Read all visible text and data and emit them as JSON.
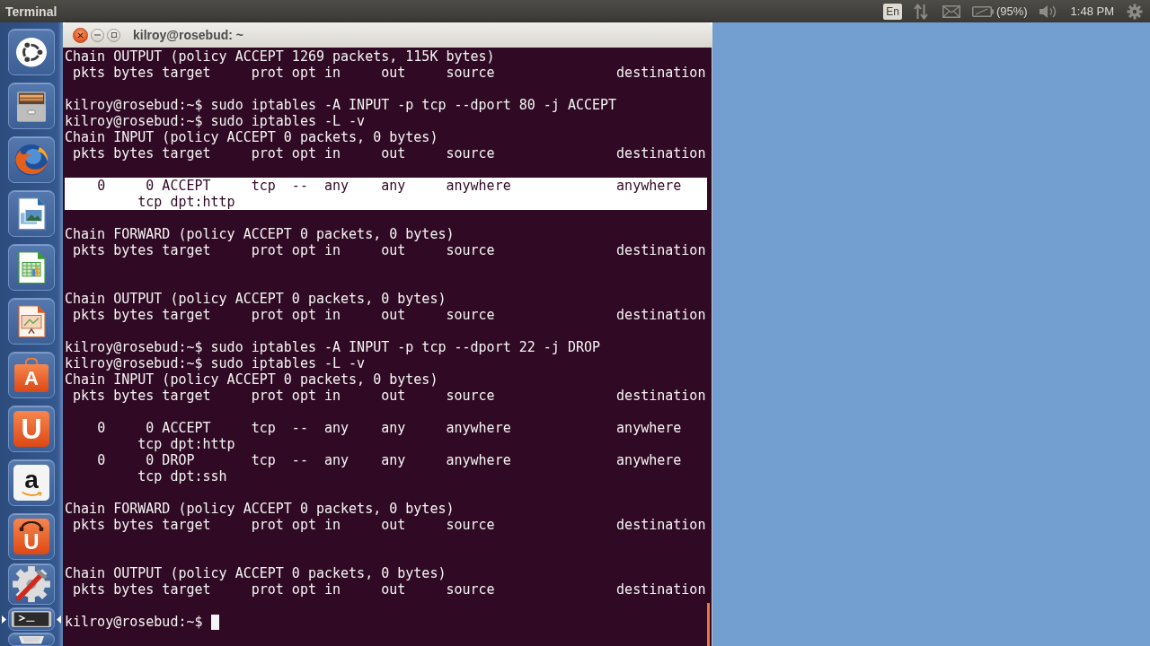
{
  "top_panel": {
    "app_title": "Terminal",
    "indicators": [
      {
        "kind": "keyboard",
        "label": "En"
      },
      {
        "kind": "network"
      },
      {
        "kind": "mail"
      },
      {
        "kind": "battery",
        "label": "(95%)"
      },
      {
        "kind": "sound"
      },
      {
        "kind": "clock",
        "label": "1:48 PM"
      },
      {
        "kind": "session"
      }
    ]
  },
  "launcher": {
    "items": [
      {
        "kind": "dash",
        "running": false,
        "focused": false
      },
      {
        "kind": "files",
        "running": false,
        "focused": false
      },
      {
        "kind": "browser",
        "running": false,
        "focused": false
      },
      {
        "kind": "draw",
        "running": false,
        "focused": false
      },
      {
        "kind": "spreadsheet",
        "running": false,
        "focused": false
      },
      {
        "kind": "presentation",
        "running": false,
        "focused": false
      },
      {
        "kind": "software",
        "glyph": "A",
        "running": false,
        "focused": false
      },
      {
        "kind": "cloud",
        "glyph": "U",
        "running": false,
        "focused": false
      },
      {
        "kind": "shop",
        "glyph": "a",
        "running": false,
        "focused": false
      },
      {
        "kind": "music",
        "glyph": "U",
        "running": false,
        "focused": false
      },
      {
        "kind": "settings",
        "running": false,
        "focused": false
      },
      {
        "kind": "terminal",
        "running": true,
        "focused": true
      },
      {
        "kind": "trash",
        "running": false,
        "focused": false
      }
    ]
  },
  "terminal": {
    "title": "kilroy@rosebud: ~",
    "lines": [
      {
        "kind": "output",
        "text": "Chain OUTPUT (policy ACCEPT 1269 packets, 115K bytes)",
        "selected": false
      },
      {
        "kind": "output",
        "text": " pkts bytes target     prot opt in     out     source               destination",
        "selected": false
      },
      {
        "kind": "blank",
        "selected": false
      },
      {
        "kind": "output",
        "text": "kilroy@rosebud:~$ sudo iptables -A INPUT -p tcp --dport 80 -j ACCEPT",
        "selected": false
      },
      {
        "kind": "output",
        "text": "kilroy@rosebud:~$ sudo iptables -L -v",
        "selected": false
      },
      {
        "kind": "output",
        "text": "Chain INPUT (policy ACCEPT 0 packets, 0 bytes)",
        "selected": false
      },
      {
        "kind": "output",
        "text": " pkts bytes target     prot opt in     out     source               destination",
        "selected": false
      },
      {
        "kind": "blank",
        "selected": false
      },
      {
        "kind": "output",
        "text": "    0     0 ACCEPT     tcp  --  any    any     anywhere             anywhere",
        "selected": true
      },
      {
        "kind": "output",
        "text": "         tcp dpt:http",
        "selected": true
      },
      {
        "kind": "blank",
        "selected": false
      },
      {
        "kind": "output",
        "text": "Chain FORWARD (policy ACCEPT 0 packets, 0 bytes)",
        "selected": false
      },
      {
        "kind": "output",
        "text": " pkts bytes target     prot opt in     out     source               destination",
        "selected": false
      },
      {
        "kind": "blank",
        "selected": false
      },
      {
        "kind": "blank",
        "selected": false
      },
      {
        "kind": "output",
        "text": "Chain OUTPUT (policy ACCEPT 0 packets, 0 bytes)",
        "selected": false
      },
      {
        "kind": "output",
        "text": " pkts bytes target     prot opt in     out     source               destination",
        "selected": false
      },
      {
        "kind": "blank",
        "selected": false
      },
      {
        "kind": "output",
        "text": "kilroy@rosebud:~$ sudo iptables -A INPUT -p tcp --dport 22 -j DROP",
        "selected": false
      },
      {
        "kind": "output",
        "text": "kilroy@rosebud:~$ sudo iptables -L -v",
        "selected": false
      },
      {
        "kind": "output",
        "text": "Chain INPUT (policy ACCEPT 0 packets, 0 bytes)",
        "selected": false
      },
      {
        "kind": "output",
        "text": " pkts bytes target     prot opt in     out     source               destination",
        "selected": false
      },
      {
        "kind": "blank",
        "selected": false
      },
      {
        "kind": "output",
        "text": "    0     0 ACCEPT     tcp  --  any    any     anywhere             anywhere",
        "selected": false
      },
      {
        "kind": "output",
        "text": "         tcp dpt:http",
        "selected": false
      },
      {
        "kind": "output",
        "text": "    0     0 DROP       tcp  --  any    any     anywhere             anywhere",
        "selected": false
      },
      {
        "kind": "output",
        "text": "         tcp dpt:ssh",
        "selected": false
      },
      {
        "kind": "blank",
        "selected": false
      },
      {
        "kind": "output",
        "text": "Chain FORWARD (policy ACCEPT 0 packets, 0 bytes)",
        "selected": false
      },
      {
        "kind": "output",
        "text": " pkts bytes target     prot opt in     out     source               destination",
        "selected": false
      },
      {
        "kind": "blank",
        "selected": false
      },
      {
        "kind": "blank",
        "selected": false
      },
      {
        "kind": "output",
        "text": "Chain OUTPUT (policy ACCEPT 0 packets, 0 bytes)",
        "selected": false
      },
      {
        "kind": "output",
        "text": " pkts bytes target     prot opt in     out     source               destination",
        "selected": false
      },
      {
        "kind": "blank",
        "selected": false
      },
      {
        "kind": "prompt",
        "text": "kilroy@rosebud:~$",
        "cursor": true,
        "selected": false
      }
    ]
  }
}
